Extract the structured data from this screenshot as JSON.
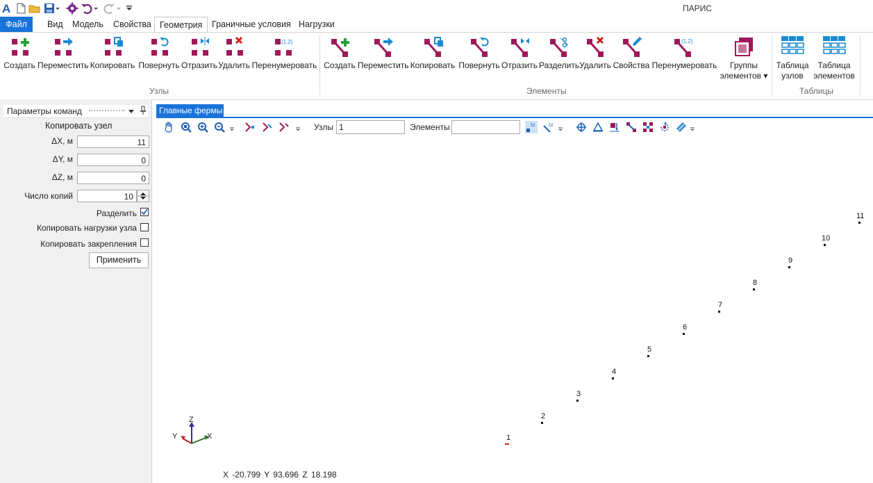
{
  "window": {
    "title": "ПАРИС"
  },
  "menu": {
    "tabs": [
      "Файл",
      "Вид",
      "Модель",
      "Свойства",
      "Геометрия",
      "Граничные условия",
      "Нагрузки"
    ],
    "active": "Геометрия"
  },
  "ribbon": {
    "nodes_group": {
      "label": "Узлы",
      "buttons": [
        "Создать",
        "Переместить",
        "Копировать",
        "Повернуть",
        "Отразить",
        "Удалить",
        "Перенумеровать"
      ]
    },
    "elements_group": {
      "label": "Элементы",
      "buttons": [
        "Создать",
        "Переместить",
        "Копировать",
        "Повернуть",
        "Отразить",
        "Разделить",
        "Удалить",
        "Свойства",
        "Перенумеровать"
      ],
      "groups_line1": "Группы",
      "groups_line2": "элементов ▾"
    },
    "tables_group": {
      "label": "Таблицы",
      "nodes_table_line1": "Таблица",
      "nodes_table_line2": "узлов",
      "elements_table_line1": "Таблица",
      "elements_table_line2": "элементов"
    },
    "accent_color": "#a0185a",
    "table_color": "#1a8ad4"
  },
  "command_panel": {
    "title": "Параметры команд",
    "pin_glyph": "📌",
    "heading": "Копировать узел",
    "dx_label": "ΔX, м",
    "dx_value": "11",
    "dy_label": "ΔY, м",
    "dy_value": "0",
    "dz_label": "ΔZ, м",
    "dz_value": "0",
    "copies_label": "Число копий",
    "copies_value": "10",
    "split_label": "Разделить",
    "split_checked": true,
    "copy_loads_label": "Копировать нагрузки узла",
    "copy_supports_label": "Копировать закрепления",
    "apply_label": "Применить"
  },
  "document": {
    "tab_title": "Главные фермы",
    "nodes_label": "Узлы",
    "nodes_value": "1",
    "elements_label": "Элементы",
    "elements_value": ""
  },
  "viewport": {
    "nodes": [
      "1",
      "2",
      "3",
      "4",
      "5",
      "6",
      "7",
      "8",
      "9",
      "10",
      "11"
    ],
    "axes": {
      "z": "Z",
      "y": "Y",
      "x": "X"
    },
    "coords": "X -20.799   Y 93.696   Z 18.198"
  }
}
